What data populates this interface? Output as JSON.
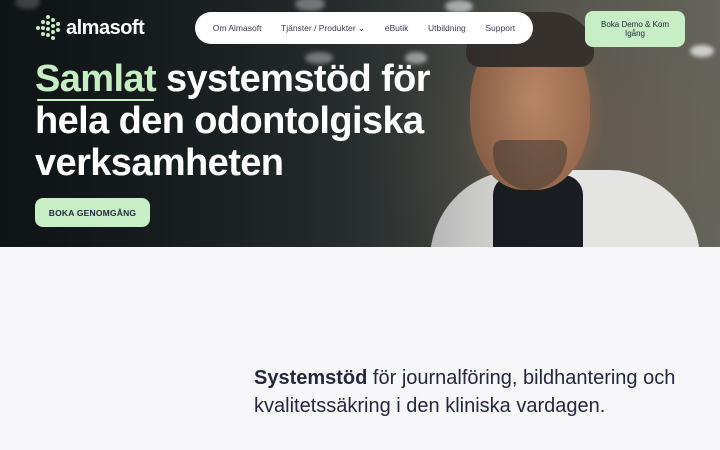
{
  "brand": {
    "name": "almasoft",
    "accent_color": "#c6edc3",
    "text_color": "#23283e"
  },
  "nav": {
    "items": [
      {
        "label": "Om Almasoft",
        "has_dropdown": false
      },
      {
        "label": "Tjänster / Produkter",
        "has_dropdown": true
      },
      {
        "label": "eButik",
        "has_dropdown": false
      },
      {
        "label": "Utbildning",
        "has_dropdown": false
      },
      {
        "label": "Support",
        "has_dropdown": false
      }
    ],
    "cta_label": "Boka Demo & Kom Igång"
  },
  "hero": {
    "headline_accent": "Samlat",
    "headline_rest": " systemstöd för hela den odontolgiska verksamheten",
    "button_label": "BOKA GENOMGÅNG"
  },
  "section": {
    "lead_strong": "Systemstöd",
    "lead_rest": " för journalföring, bildhantering och kvalitetssäkring i den kliniska vardagen."
  },
  "icons": {
    "logo": "almasoft-dots-logo-icon",
    "dropdown": "chevron-down-icon"
  }
}
